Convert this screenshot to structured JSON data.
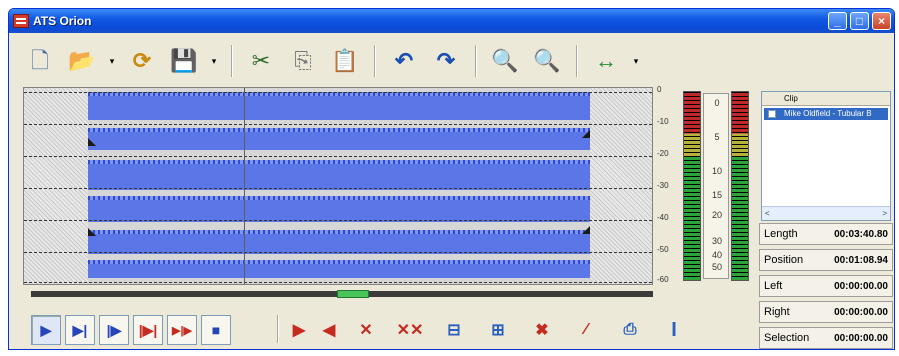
{
  "window": {
    "title": "ATS Orion",
    "min": "_",
    "max": "□",
    "close": "×"
  },
  "toolbar": {
    "new": "🗋",
    "open": "📂",
    "reload": "⟳",
    "save": "💾",
    "cut": "✂",
    "copy": "⎘",
    "paste": "📋",
    "undo": "↶",
    "redo": "↷",
    "zoom_in": "🔍",
    "zoom_out": "🔍",
    "fit": "↔",
    "dropdown": "▾"
  },
  "waveform": {
    "db_labels": [
      "0",
      "-10",
      "-20",
      "-30",
      "-40",
      "-50",
      "-60"
    ]
  },
  "meter": {
    "scale_labels": [
      "0",
      "5",
      "10",
      "15",
      "20",
      "30",
      "40",
      "50"
    ]
  },
  "clip_list": {
    "header": "Clip",
    "item": "Mike Oldfield - Tubular B",
    "scroll_left": "<",
    "scroll_right": ">"
  },
  "info": {
    "length_label": "Length",
    "length_value": "00:03:40.80",
    "position_label": "Position",
    "position_value": "00:01:08.94",
    "left_label": "Left",
    "left_value": "00:00:00.00",
    "right_label": "Right",
    "right_value": "00:00:00.00",
    "selection_label": "Selection",
    "selection_value": "00:00:00.00"
  },
  "transport": {
    "play": "▶",
    "play_to_end": "▶|",
    "play_sel": "|▶",
    "play_from": "|▶|",
    "loop": "▶|▶",
    "stop": "■"
  },
  "edit": {
    "mark_right": "▶",
    "mark_left": "◀",
    "del1": "✕",
    "del2": "✕✕",
    "trim1": "⊟",
    "trim2": "⊞",
    "cut_x": "✖",
    "split": "⁄",
    "export": "⎙",
    "cursor": "I"
  },
  "colors": {
    "wave": "#5b76e6",
    "titlebar": "#0a4ad6",
    "meter_green": "#2ea23b",
    "meter_red": "#c0292b"
  }
}
